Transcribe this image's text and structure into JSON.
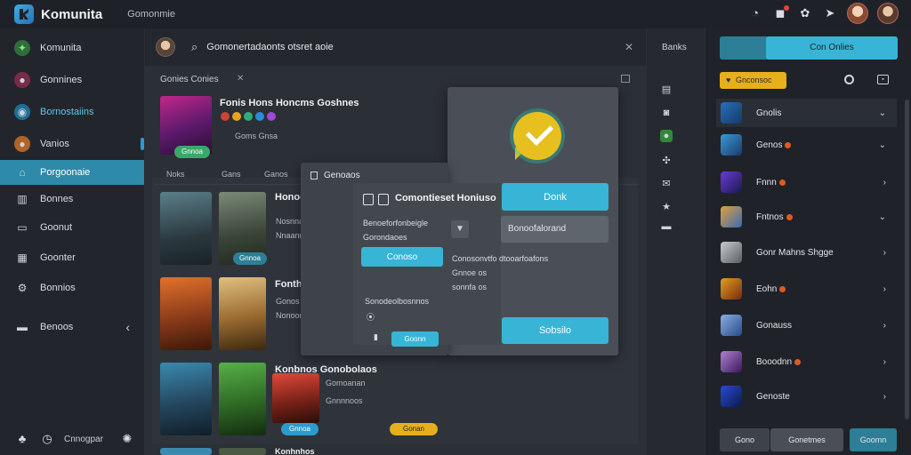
{
  "app": {
    "name": "Komunita",
    "subtitle": "Gomonmie"
  },
  "topbar": {
    "icons": [
      "help-icon",
      "notification-icon",
      "settings-icon",
      "send-icon"
    ]
  },
  "sidebar": {
    "items": [
      {
        "label": "Komunita",
        "icon": "community-icon"
      },
      {
        "label": "Gonnines",
        "icon": "games-icon"
      },
      {
        "label": "Bornostaiins",
        "icon": "store-icon"
      },
      {
        "label": "Vanios",
        "icon": "video-icon"
      },
      {
        "label": "Porgoonaie",
        "icon": "home-icon"
      },
      {
        "label": "Bonnes",
        "icon": "library-icon"
      },
      {
        "label": "Goonut",
        "icon": "chat-icon"
      },
      {
        "label": "Goonter",
        "icon": "grid-icon"
      },
      {
        "label": "Bonnios",
        "icon": "gear-icon"
      },
      {
        "label": "Benoos",
        "icon": "folder-icon"
      }
    ],
    "footer_label": "Cnnogpar"
  },
  "search": {
    "text": "Gomonertadaonts otsret aoie"
  },
  "section": {
    "title": "Gonies Conies"
  },
  "featured": {
    "title": "Fonis Hons Honcms Goshnes",
    "sub": "Goms Gnsa",
    "pill": "Gnnoa"
  },
  "tabs": [
    "Noks",
    "Gans",
    "Ganos"
  ],
  "rows": [
    {
      "title": "Honoos",
      "sub1": "Nosnnass",
      "sub2": "Nnaannas",
      "pill": "Gnnoa"
    },
    {
      "title": "Fonthnitos",
      "sub1": "Gonos",
      "sub2": "Nonoonos",
      "pill": "Gnnoa"
    },
    {
      "title": "Konbnos Gonobolaos",
      "sub1": "Gomoanan",
      "sub2": "Gnnnnoos",
      "pill": "Gnnoa",
      "pill2": "Gonan"
    },
    {
      "title": "Konhnhos"
    }
  ],
  "dialog": {
    "heading": "Genoaos",
    "title": "Comontieset Honiuso",
    "rows": [
      "Benoeforfonbeigle",
      "Gorondaoes",
      "Sonodeolbosnnos",
      "Conosonvtfo dtooarfoafons",
      "Gnnoe os",
      "sonnfa os",
      "Gonodetaenobons"
    ],
    "connect_button": "Conoso",
    "ok_button": "Donk",
    "field_value": "Bonoofalorand",
    "confirm_button": "Sobsilo",
    "small_button": "Goonn"
  },
  "rail": {
    "label": "Banks",
    "icons": [
      "library-icon",
      "camera-icon",
      "game-icon",
      "puzzle-icon",
      "mail-icon",
      "star-icon",
      "inbox-icon"
    ]
  },
  "rpanel": {
    "top_button": "Con Onlies",
    "yellow_button": "Gnconsoc",
    "friends": [
      {
        "name": "Gnolis",
        "status": false
      },
      {
        "name": "Genos",
        "status": true
      },
      {
        "name": "Fnnn",
        "status": true
      },
      {
        "name": "Fntnos",
        "status": true
      },
      {
        "name": "Gonr Mahns Shgge",
        "status": false
      },
      {
        "name": "Eohn",
        "status": true
      },
      {
        "name": "Gonauss",
        "status": false
      },
      {
        "name": "Booodnn",
        "status": true
      },
      {
        "name": "Genoste",
        "status": false
      }
    ],
    "bottom_left": "Gono",
    "bottom_mid": "Gonetmes",
    "bottom_right": "Goomn"
  },
  "colors": {
    "accent": "#38b5d6",
    "active_nav": "#2d8aa8",
    "yellow": "#e6b01c",
    "panel_bg": "#1f2329"
  }
}
